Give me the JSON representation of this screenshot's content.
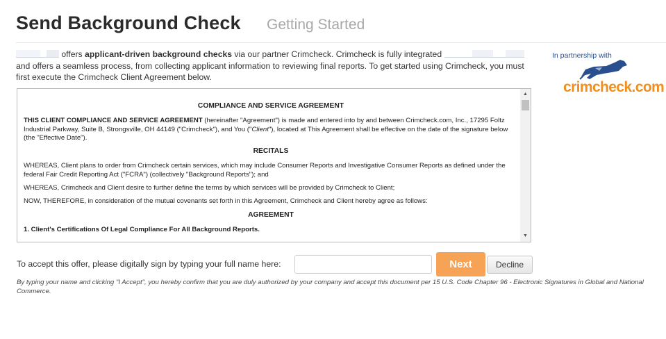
{
  "header": {
    "title": "Send Background Check",
    "subtitle": "Getting Started"
  },
  "intro": {
    "part1": "offers ",
    "bold": "applicant-driven background checks",
    "part2": " via our partner Crimcheck. Crimcheck is fully integrated",
    "part3": "and offers a seamless process, from collecting applicant information to reviewing final reports. To get started using Crimcheck, you must first execute the Crimcheck Client Agreement below."
  },
  "partner_logo": {
    "tagline": "In partnership with",
    "wordmark": "crimcheck.com"
  },
  "agreement": {
    "heading": "COMPLIANCE AND SERVICE AGREEMENT",
    "para1_bold": "THIS CLIENT COMPLIANCE AND SERVICE AGREEMENT",
    "para1_rest_a": " (hereinafter \"Agreement\") is made and entered into by and between Crimcheck.com, Inc., 17295 Foltz Industrial Parkway, Suite B, Strongsville, OH 44149 (\"Crimcheck\"), and You (\"",
    "para1_client": "Client",
    "para1_rest_b": "\"), located at This Agreement shall be effective on the date of the signature below (the \"Effective Date\").",
    "recitals_heading": "RECITALS",
    "recital1": "WHEREAS, Client plans to order from Crimcheck certain services, which may include Consumer Reports and Investigative Consumer Reports as defined under the federal Fair Credit Reporting Act (\"FCRA\") (collectively \"Background Reports\"); and",
    "recital2": "WHEREAS, Crimcheck and Client desire to further define the terms by which services will be provided by Crimcheck to Client;",
    "recital3": "NOW, THEREFORE, in consideration of the mutual covenants set forth in this Agreement, Crimcheck and Client hereby agree as follows:",
    "agreement_heading": "AGREEMENT",
    "section1": "1. Client's Certifications Of Legal Compliance For All Background Reports."
  },
  "signature": {
    "label": "To accept this offer, please digitally sign by typing your full name here:",
    "input_value": "",
    "next_label": "Next",
    "decline_label": "Decline"
  },
  "disclaimer": "By typing your name and clicking \"I Accept\", you hereby confirm that you are duly authorized by your company and accept this document per 15 U.S. Code Chapter 96 - Electronic Signatures in Global and National Commerce.",
  "colors": {
    "next_button": "#f6a356",
    "logo_orange": "#f08f1d",
    "logo_blue": "#2a4f8f"
  }
}
